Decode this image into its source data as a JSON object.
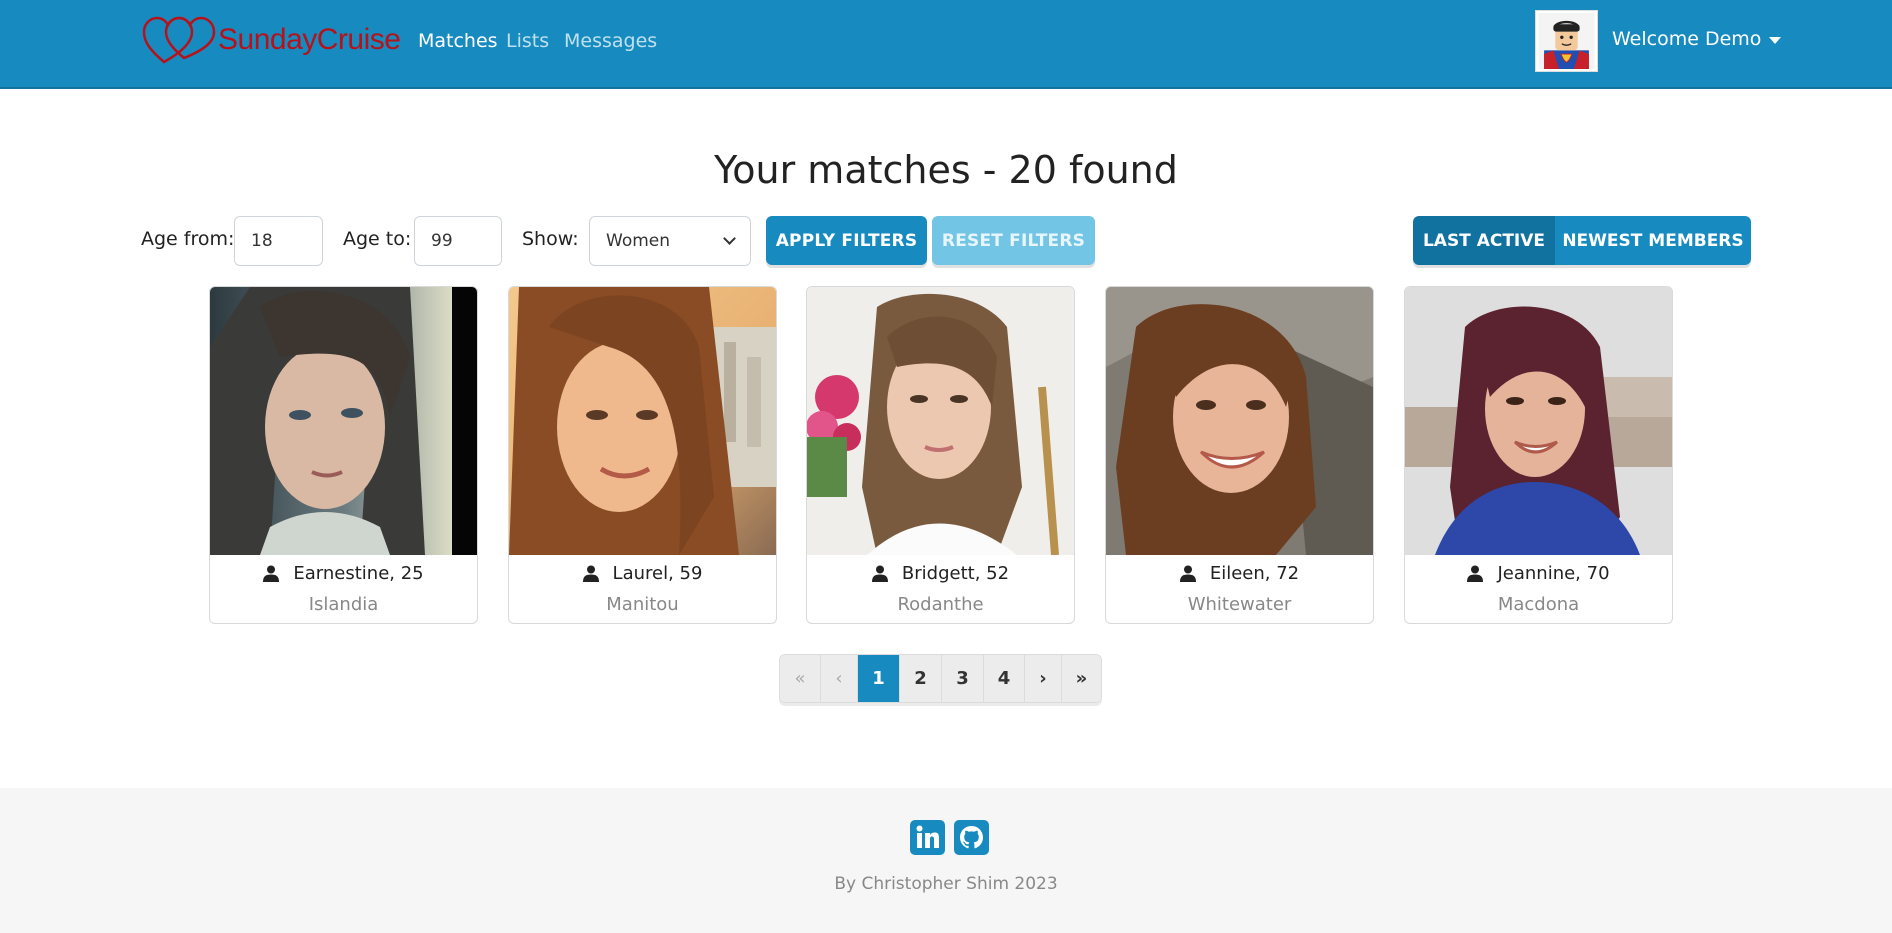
{
  "navbar": {
    "brand": "SundayCruise",
    "links": [
      {
        "label": "Matches",
        "active": true
      },
      {
        "label": "Lists",
        "active": false
      },
      {
        "label": "Messages",
        "active": false
      }
    ],
    "welcome": "Welcome Demo",
    "avatar_icon": "superhero-avatar",
    "brand_icon": "hearts-logo-icon"
  },
  "page": {
    "title": "Your matches - 20 found"
  },
  "filters": {
    "age_from_label": "Age from:",
    "age_from_value": "18",
    "age_to_label": "Age to:",
    "age_to_value": "99",
    "show_label": "Show:",
    "show_value": "Women",
    "apply_label": "Apply filters",
    "reset_label": "Reset filters",
    "sort_options": [
      "Last Active",
      "Newest Members"
    ],
    "sort_selected": "Last Active"
  },
  "members": [
    {
      "name": "Earnestine, 25",
      "city": "Islandia"
    },
    {
      "name": "Laurel, 59",
      "city": "Manitou"
    },
    {
      "name": "Bridgett, 52",
      "city": "Rodanthe"
    },
    {
      "name": "Eileen, 72",
      "city": "Whitewater"
    },
    {
      "name": "Jeannine, 70",
      "city": "Macdona"
    }
  ],
  "pagination": {
    "first": "«",
    "prev": "‹",
    "pages": [
      "1",
      "2",
      "3",
      "4"
    ],
    "current": "1",
    "next": "›",
    "last": "»"
  },
  "footer": {
    "credit": "By Christopher Shim 2023",
    "icons": [
      "linkedin-icon",
      "github-icon"
    ]
  },
  "colors": {
    "primary": "#178bbf",
    "primary_dark": "#12729f",
    "primary_light": "#73c5e6",
    "brand_red": "#b5121b"
  }
}
